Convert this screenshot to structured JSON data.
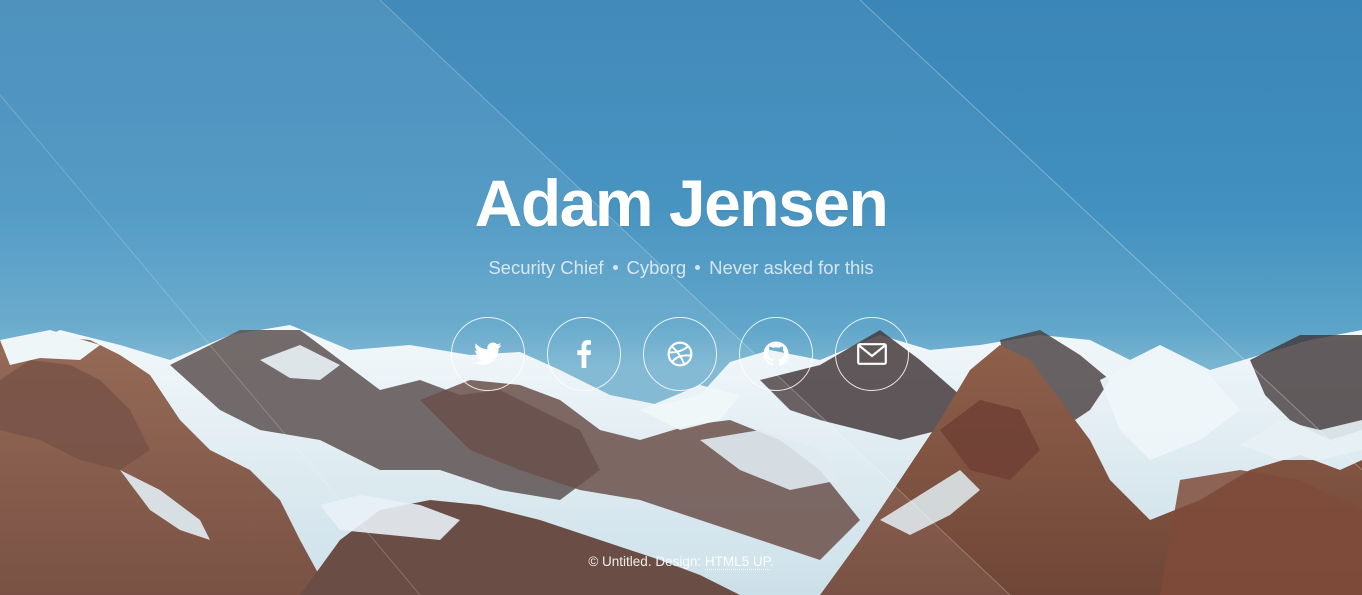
{
  "header": {
    "title": "Adam Jensen",
    "tagline": [
      "Security Chief",
      "Cyborg",
      "Never asked for this"
    ]
  },
  "social": [
    {
      "icon": "twitter-icon",
      "name": "social-twitter-button"
    },
    {
      "icon": "facebook-icon",
      "name": "social-facebook-button"
    },
    {
      "icon": "dribbble-icon",
      "name": "social-dribbble-button"
    },
    {
      "icon": "github-icon",
      "name": "social-github-button"
    },
    {
      "icon": "envelope-icon",
      "name": "social-email-button"
    }
  ],
  "footer": {
    "copyright": "© Untitled. Design:",
    "link_label": "HTML5 UP",
    "period": "."
  },
  "colors": {
    "sky": "#3b86b7",
    "text": "#ffffff",
    "snow": "#dfeef4",
    "rock": "#7a4f3f"
  }
}
